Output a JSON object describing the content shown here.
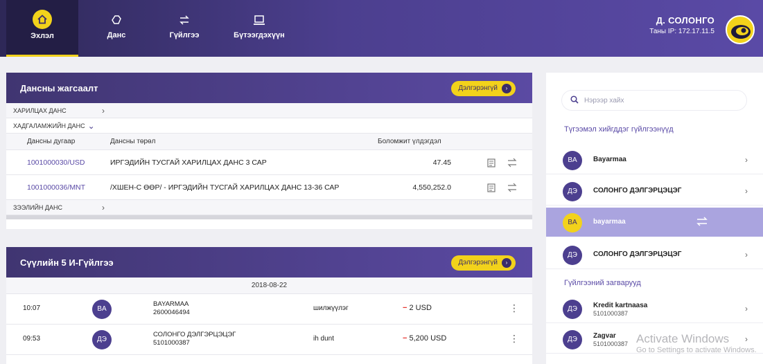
{
  "nav": {
    "items": [
      {
        "label": "Эхлэл",
        "icon": "home-icon"
      },
      {
        "label": "Данс",
        "icon": "piggy-bank-icon"
      },
      {
        "label": "Гүйлгээ",
        "icon": "transfer-icon"
      },
      {
        "label": "Бүтээгдэхүүн",
        "icon": "laptop-icon"
      }
    ],
    "active_index": 0
  },
  "user": {
    "name": "Д. СОЛОНГО",
    "ip": "Таны IP: 172.17.11.5"
  },
  "accounts": {
    "title": "Дансны жагсаалт",
    "more": "Дэлгэрэнгүй",
    "cat_current": "ХАРИЛЦАХ ДАНС",
    "cat_savings": "ХАДГАЛАМЖИЙН ДАНС",
    "cat_loan": "ЗЭЭЛИЙН ДАНС",
    "columns": [
      "Дансны дугаар",
      "Дансны төрөл",
      "Боломжит үлдэгдэл"
    ],
    "rows": [
      {
        "number": "1001000030/USD",
        "type": "ИРГЭДИЙН ТУСГАЙ ХАРИЛЦАХ ДАНС 3 САР",
        "balance": "47.45"
      },
      {
        "number": "1001000036/MNT",
        "type": "/ХШЕН-С ӨӨР/ - ИРГЭДИЙН ТУСГАЙ ХАРИЛЦАХ ДАНС 13-36 САР",
        "balance": "4,550,252.0"
      }
    ]
  },
  "transactions": {
    "title": "Сүүлийн 5 И-Гүйлгээ",
    "more": "Дэлгэрэнгүй",
    "date": "2018-08-22",
    "rows": [
      {
        "time": "10:07",
        "initials": "BA",
        "name": "BAYARMAA",
        "account": "2600046494",
        "desc": "шилжүүлэг",
        "sign": "−",
        "amount": "2 USD"
      },
      {
        "time": "09:53",
        "initials": "ДЭ",
        "name": "СОЛОНГО ДЭЛГЭРЦЭЦЭГ",
        "account": "5101000387",
        "desc": "ih dunt",
        "sign": "−",
        "amount": "5,200 USD"
      }
    ]
  },
  "sidebar": {
    "search_placeholder": "Нэрээр хайх",
    "frequent_title": "Түгээмэл хийгддэг гүйлгээнүүд",
    "frequent": [
      {
        "initials": "BA",
        "name": "Bayarmaa"
      },
      {
        "initials": "ДЭ",
        "name": "СОЛОНГО ДЭЛГЭРЦЭЦЭГ"
      },
      {
        "initials": "BA",
        "name": "bayarmaa"
      },
      {
        "initials": "ДЭ",
        "name": "СОЛОНГО ДЭЛГЭРЦЭЦЭГ"
      }
    ],
    "templates_title": "Гүйлгээний загварууд",
    "templates": [
      {
        "initials": "ДЭ",
        "name": "Kredit kartnaasa",
        "account": "5101000387"
      },
      {
        "initials": "ДЭ",
        "name": "Zagvar",
        "account": "5101000387"
      }
    ]
  },
  "watermark": {
    "line1": "Activate Windows",
    "line2": "Go to Settings to activate Windows."
  },
  "colors": {
    "accent": "#f2d21b",
    "primary": "#4c3f8f",
    "negative": "#e5322d"
  }
}
